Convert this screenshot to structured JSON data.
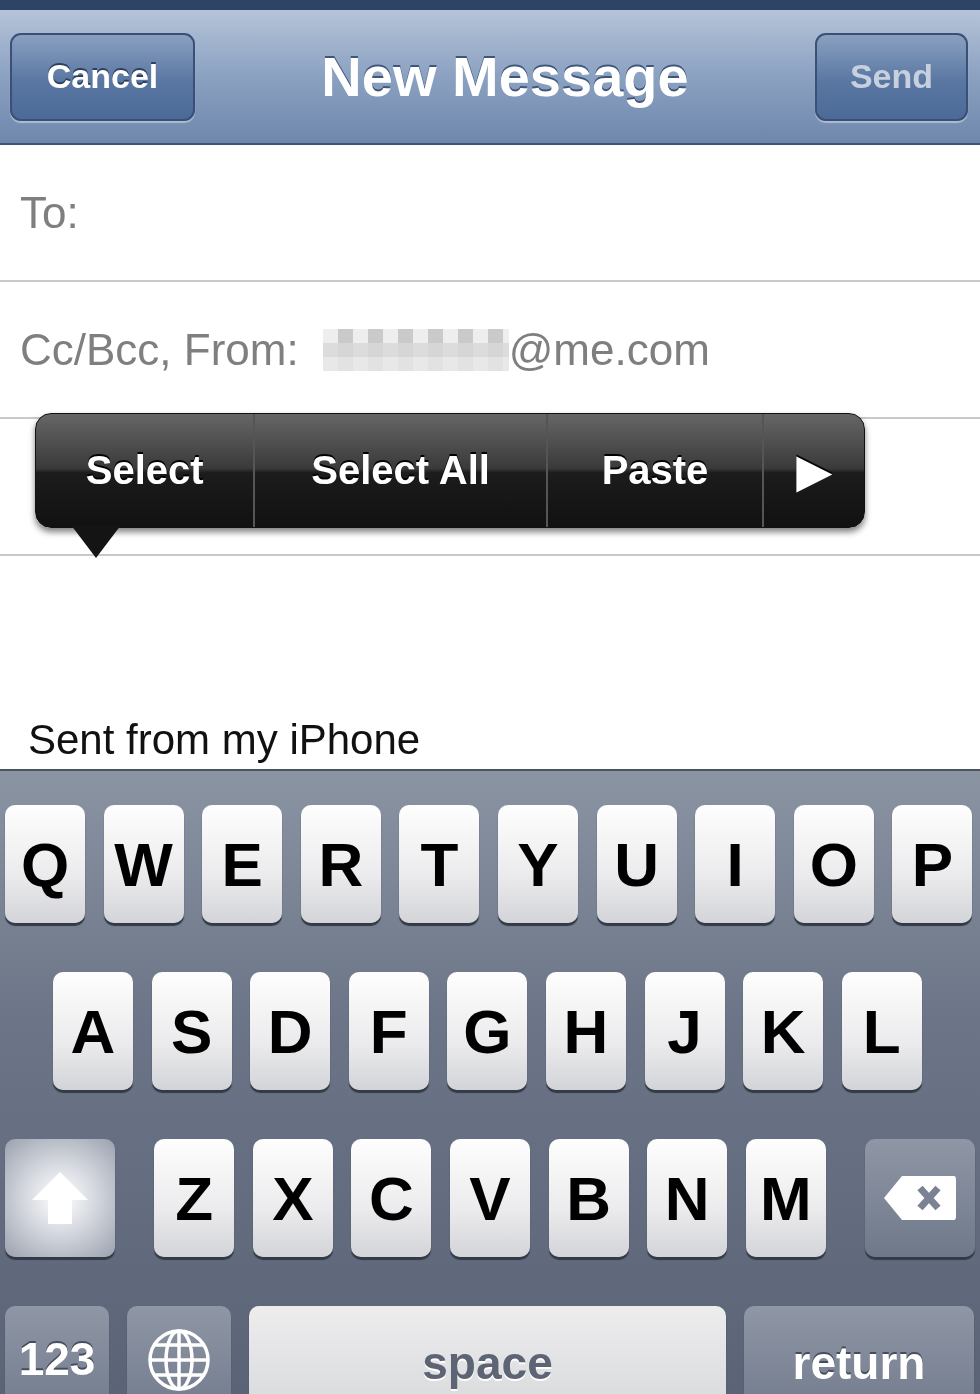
{
  "nav": {
    "cancel": "Cancel",
    "title": "New Message",
    "send": {
      "label": "Send",
      "disabled": true
    }
  },
  "fields": [
    {
      "label": "To:"
    },
    {
      "label": "Cc/Bcc, From:",
      "value": "@me.com",
      "redacted": true
    }
  ],
  "edit_menu": {
    "items": [
      {
        "kind": "text",
        "label": "Select"
      },
      {
        "kind": "text",
        "label": "Select All"
      },
      {
        "kind": "text",
        "label": "Paste"
      },
      {
        "kind": "more",
        "label": "▶"
      }
    ]
  },
  "body": {
    "signature": "Sent from my iPhone"
  },
  "keyboard": {
    "rows": [
      {
        "keys": [
          {
            "kind": "letter",
            "label": "Q"
          },
          {
            "kind": "letter",
            "label": "W"
          },
          {
            "kind": "letter",
            "label": "E"
          },
          {
            "kind": "letter",
            "label": "R"
          },
          {
            "kind": "letter",
            "label": "T"
          },
          {
            "kind": "letter",
            "label": "Y"
          },
          {
            "kind": "letter",
            "label": "U"
          },
          {
            "kind": "letter",
            "label": "I"
          },
          {
            "kind": "letter",
            "label": "O"
          },
          {
            "kind": "letter",
            "label": "P"
          }
        ]
      },
      {
        "keys": [
          {
            "kind": "letter",
            "label": "A"
          },
          {
            "kind": "letter",
            "label": "S"
          },
          {
            "kind": "letter",
            "label": "D"
          },
          {
            "kind": "letter",
            "label": "F"
          },
          {
            "kind": "letter",
            "label": "G"
          },
          {
            "kind": "letter",
            "label": "H"
          },
          {
            "kind": "letter",
            "label": "J"
          },
          {
            "kind": "letter",
            "label": "K"
          },
          {
            "kind": "letter",
            "label": "L"
          }
        ]
      },
      {
        "keys": [
          {
            "kind": "shift",
            "on": true
          },
          {
            "kind": "letter",
            "label": "Z"
          },
          {
            "kind": "letter",
            "label": "X"
          },
          {
            "kind": "letter",
            "label": "C"
          },
          {
            "kind": "letter",
            "label": "V"
          },
          {
            "kind": "letter",
            "label": "B"
          },
          {
            "kind": "letter",
            "label": "N"
          },
          {
            "kind": "letter",
            "label": "M"
          },
          {
            "kind": "delete"
          }
        ]
      },
      {
        "keys": [
          {
            "kind": "mode",
            "label": "123"
          },
          {
            "kind": "globe"
          },
          {
            "kind": "space",
            "label": "space"
          },
          {
            "kind": "return",
            "label": "return"
          }
        ]
      }
    ]
  }
}
